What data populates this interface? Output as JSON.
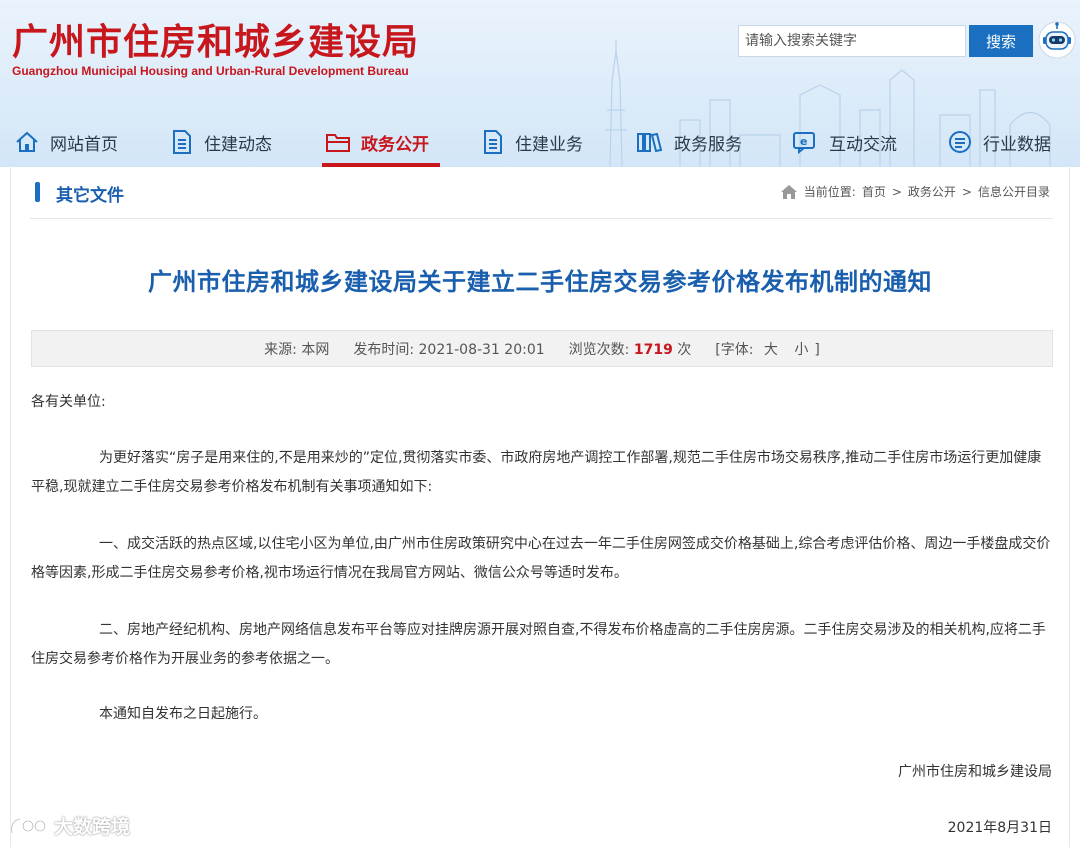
{
  "header": {
    "logo_cn": "广州市住房和城乡建设局",
    "logo_en": "Guangzhou Municipal Housing and Urban-Rural Development Bureau",
    "search_placeholder": "请输入搜索关键字",
    "search_button": "搜索"
  },
  "nav": {
    "items": [
      {
        "label": "网站首页",
        "icon": "home-icon"
      },
      {
        "label": "住建动态",
        "icon": "document-icon"
      },
      {
        "label": "政务公开",
        "icon": "folder-icon"
      },
      {
        "label": "住建业务",
        "icon": "document-icon"
      },
      {
        "label": "政务服务",
        "icon": "books-icon"
      },
      {
        "label": "互动交流",
        "icon": "chat-icon"
      },
      {
        "label": "行业数据",
        "icon": "data-icon"
      }
    ],
    "active_index": 2
  },
  "section": {
    "title": "其它文件"
  },
  "breadcrumb": {
    "prefix": "当前位置:",
    "items": [
      "首页",
      "政务公开",
      "信息公开目录"
    ],
    "separator": ">"
  },
  "article": {
    "title": "广州市住房和城乡建设局关于建立二手住房交易参考价格发布机制的通知",
    "meta": {
      "source_label": "来源:",
      "source": "本网",
      "time_label": "发布时间:",
      "time": "2021-08-31 20:01",
      "views_label": "浏览次数:",
      "views": "1719",
      "views_unit": "次",
      "font_label": "[字体:",
      "font_large": "大",
      "font_small": "小",
      "font_close": "]"
    },
    "salutation": "各有关单位:",
    "paragraphs": [
      "为更好落实“房子是用来住的,不是用来炒的”定位,贯彻落实市委、市政府房地产调控工作部署,规范二手住房市场交易秩序,推动二手住房市场运行更加健康平稳,现就建立二手住房交易参考价格发布机制有关事项通知如下:",
      "一、成交活跃的热点区域,以住宅小区为单位,由广州市住房政策研究中心在过去一年二手住房网签成交价格基础上,综合考虑评估价格、周边一手楼盘成交价格等因素,形成二手住房交易参考价格,视市场运行情况在我局官方网站、微信公众号等适时发布。",
      "二、房地产经纪机构、房地产网络信息发布平台等应对挂牌房源开展对照自查,不得发布价格虚高的二手住房房源。二手住房交易涉及的相关机构,应将二手住房交易参考价格作为开展业务的参考依据之一。",
      "本通知自发布之日起施行。"
    ],
    "signature": "广州市住房和城乡建设局",
    "date": "2021年8月31日"
  },
  "watermark": "大数跨境",
  "colors": {
    "brand_red": "#c8161d",
    "brand_blue": "#1a6fc0",
    "title_blue": "#1a5fae"
  }
}
